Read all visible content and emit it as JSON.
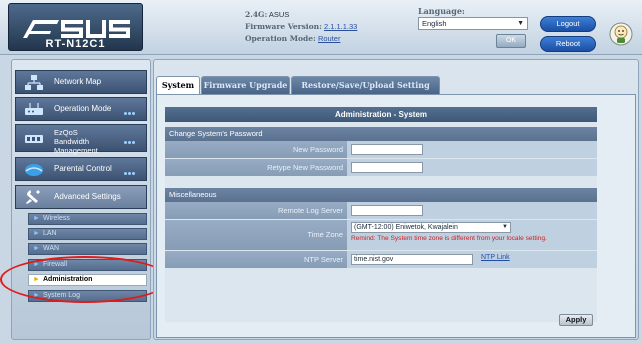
{
  "header": {
    "brand": "ASUS",
    "model": "RT-N12C1",
    "info": {
      "ssid_label": "2.4G:",
      "ssid_value": "ASUS",
      "firmware_label": "Firmware Version:",
      "firmware_value": "2.1.1.1.33",
      "mode_label": "Operation Mode:",
      "mode_value": "Router"
    },
    "language": {
      "label": "Language:",
      "selected": "English",
      "ok_label": "OK"
    },
    "logout_label": "Logout",
    "reboot_label": "Reboot"
  },
  "sidebar": {
    "menu": [
      {
        "label": "Network Map",
        "icon": "network-map-icon"
      },
      {
        "label": "Operation Mode",
        "icon": "operation-mode-icon"
      },
      {
        "label": "EzQoS Bandwidth Management",
        "line1": "EzQoS",
        "line2": "Bandwidth",
        "line3": "Management",
        "icon": "ezqos-icon"
      },
      {
        "label": "Parental Control",
        "icon": "parental-control-icon"
      },
      {
        "label": "Advanced Settings",
        "icon": "advanced-settings-icon"
      }
    ],
    "sub_items": [
      {
        "label": "Wireless"
      },
      {
        "label": "LAN"
      },
      {
        "label": "WAN"
      },
      {
        "label": "Firewall"
      },
      {
        "label": "Administration"
      },
      {
        "label": "System Log"
      }
    ],
    "selected_sub_item": "Administration"
  },
  "tabs": [
    {
      "label": "System",
      "active": true
    },
    {
      "label": "Firmware Upgrade",
      "active": false
    },
    {
      "label": "Restore/Save/Upload Setting",
      "active": false
    }
  ],
  "panel": {
    "title": "Administration - System",
    "password_section": {
      "heading": "Change System's Password",
      "new_password_label": "New Password",
      "retype_password_label": "Retype New Password"
    },
    "misc_section": {
      "heading": "Miscellaneous",
      "remote_log_label": "Remote Log Server",
      "time_zone_label": "Time Zone",
      "time_zone_value": "(GMT-12:00) Eniwetok, Kwajalein",
      "time_zone_remind": "Remind: The System time zone is different from your locale setting.",
      "ntp_label": "NTP Server",
      "ntp_value": "time.nist.gov",
      "ntp_link": "NTP Link"
    },
    "apply_label": "Apply"
  },
  "help_icon_text": "?",
  "colors": {
    "accent_blue": "#1b4fa3",
    "panel_header": "#3e5878",
    "remind_red": "#d12020",
    "highlight_ring": "#e11a1a"
  }
}
